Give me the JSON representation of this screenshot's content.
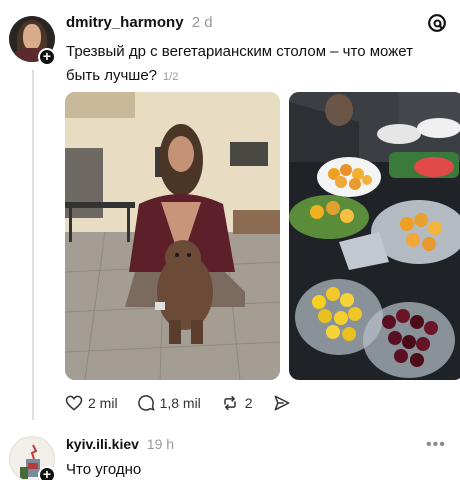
{
  "post": {
    "username": "dmitry_harmony",
    "timestamp": "2 d",
    "text": "Трезвый др с вегетарианским столом – что может быть лучше?",
    "page_count": "1/2"
  },
  "actions": {
    "likes": "2 mil",
    "comments": "1,8 mil",
    "reposts": "2"
  },
  "reply": {
    "username": "kyiv.ili.kiev",
    "timestamp": "19 h",
    "text": "Что угодно",
    "more": "•••"
  },
  "icons": {
    "brand": "threads-icon",
    "like": "heart-icon",
    "comment": "comment-icon",
    "repost": "repost-icon",
    "share": "send-icon"
  }
}
